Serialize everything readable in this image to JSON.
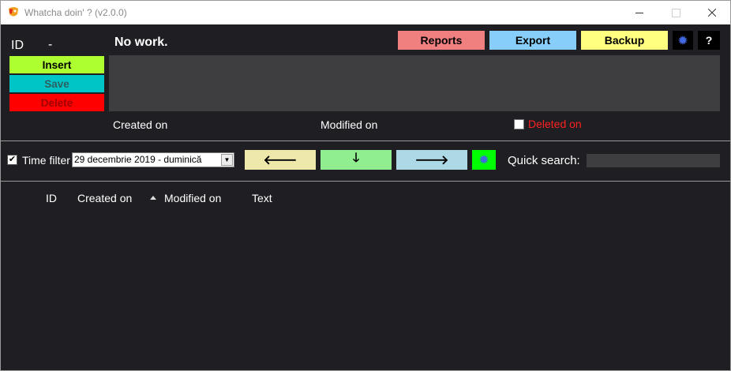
{
  "window": {
    "title": "Whatcha doin' ?  (v2.0.0)",
    "icon": "app-logo-icon"
  },
  "entry": {
    "id_label": "ID",
    "id_value": "-",
    "status": "No work.",
    "text": "",
    "created_label": "Created on",
    "modified_label": "Modified on",
    "deleted_label": "Deleted on",
    "deleted_checked": false
  },
  "actions": {
    "insert": "Insert",
    "save": "Save",
    "delete": "Delete"
  },
  "toolbar": {
    "reports": "Reports",
    "export": "Export",
    "backup": "Backup",
    "settings_icon": "gear-icon",
    "help": "?"
  },
  "filter": {
    "time_filter_label": "Time filter",
    "time_filter_checked": true,
    "date_value": "29 decembrie 2019 - duminică",
    "prev_glyph": "🡐",
    "down_glyph": "🡓",
    "next_glyph": "🡒",
    "quick_search_label": "Quick search:",
    "quick_search_value": ""
  },
  "table": {
    "columns": [
      "ID",
      "Created on",
      "Modified on",
      "Text"
    ],
    "sorted_column": "Modified on",
    "sort_direction": "ascending",
    "rows": []
  },
  "colors": {
    "background": "#1f1f23",
    "insert": "#adff2f",
    "save": "#00c5c6",
    "delete": "#ff0000",
    "reports": "#f08080",
    "export": "#87cefa",
    "backup": "#ffff80",
    "prev": "#eee8aa",
    "down": "#90ee90",
    "next": "#add8e6",
    "refresh": "#00ff00",
    "deleted_text": "#ff2020"
  }
}
